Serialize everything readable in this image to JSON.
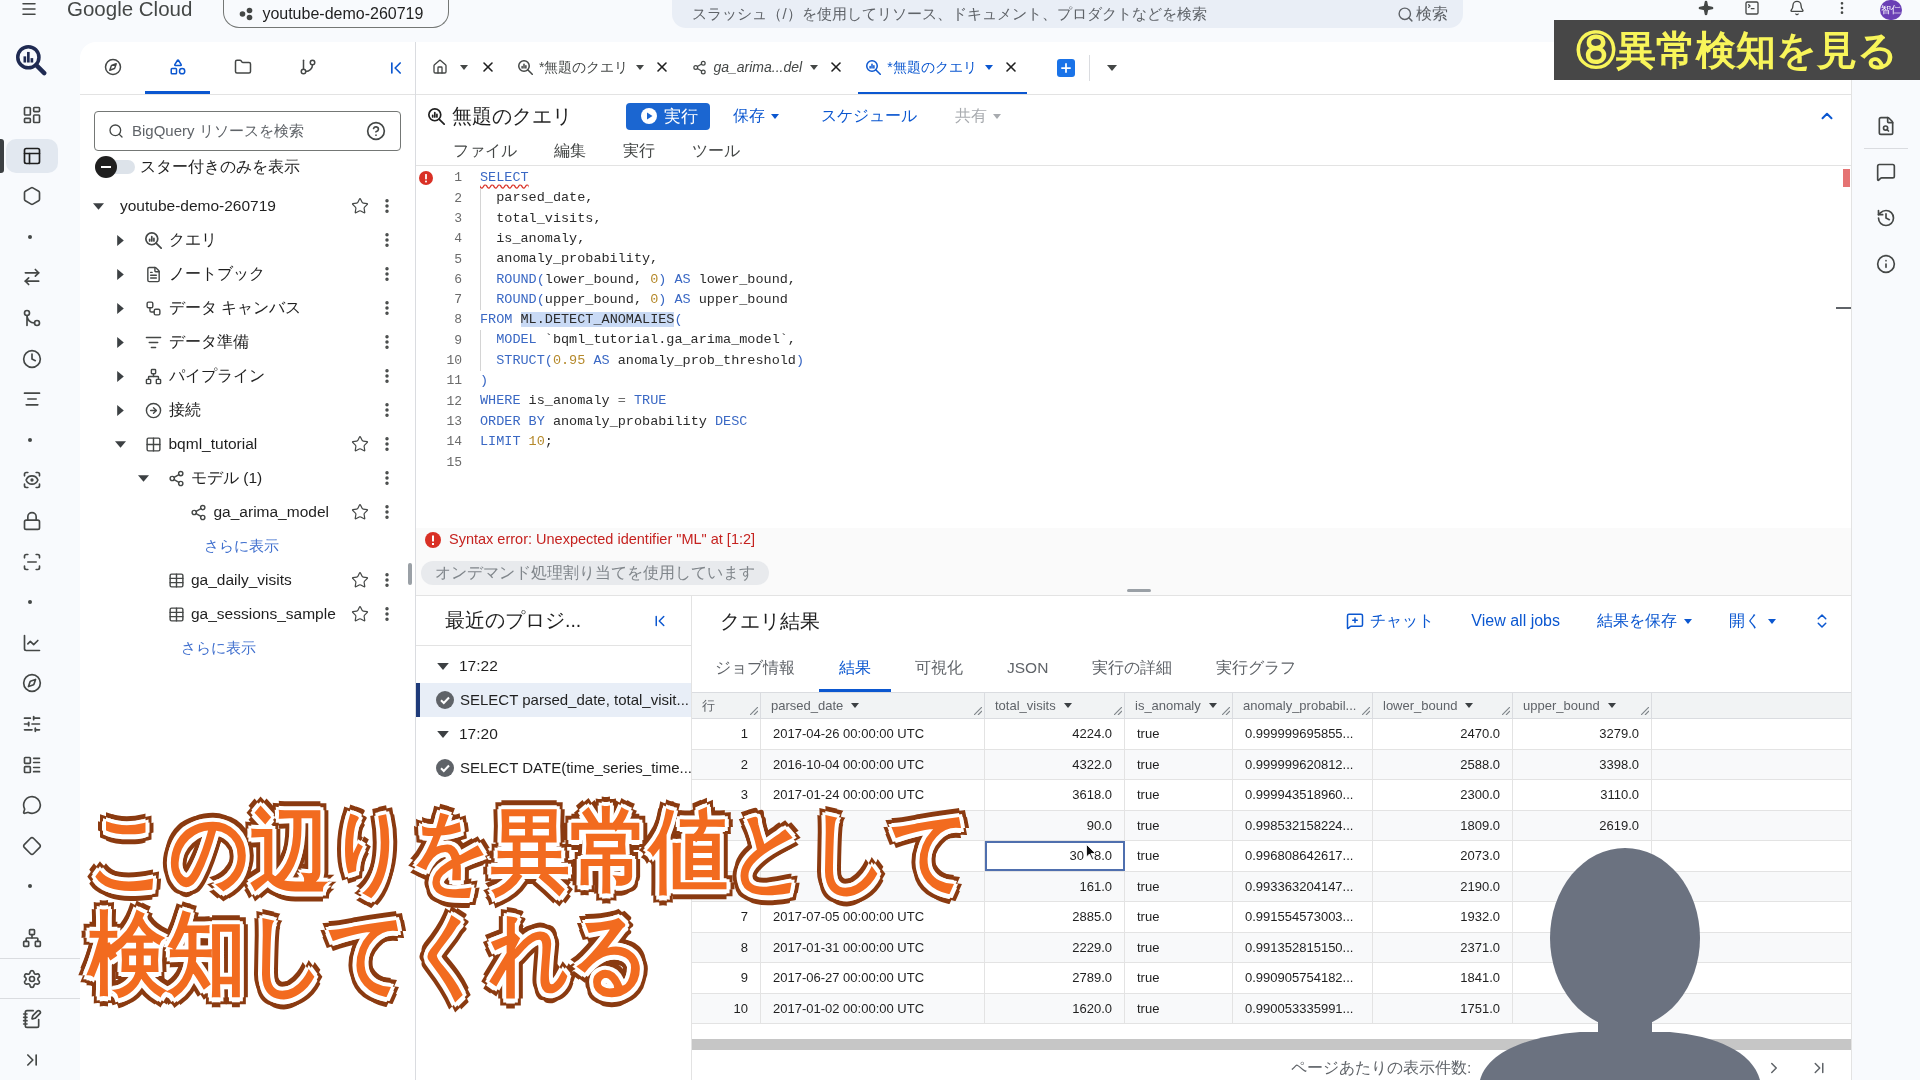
{
  "header": {
    "brand": "Google Cloud",
    "project": "youtube-demo-260719",
    "search": {
      "placeholder": "スラッシュ（/）を使用してリソース、ドキュメント、プロダクトなどを検索",
      "button": "検索"
    },
    "avatar": "智仁"
  },
  "rail": [
    {
      "kind": "dashboard",
      "selected": false
    },
    {
      "kind": "studio",
      "selected": true
    },
    {
      "kind": "hexagon",
      "selected": false
    },
    {
      "kind": "dot"
    },
    {
      "kind": "transfer",
      "selected": false
    },
    {
      "kind": "merge",
      "selected": false
    },
    {
      "kind": "clock",
      "selected": false
    },
    {
      "kind": "lines",
      "selected": false
    },
    {
      "kind": "dot"
    },
    {
      "kind": "scan_eye",
      "selected": false
    },
    {
      "kind": "lock",
      "selected": false
    },
    {
      "kind": "scan",
      "selected": false
    },
    {
      "kind": "dot"
    },
    {
      "kind": "chart",
      "selected": false
    },
    {
      "kind": "compass",
      "selected": false
    },
    {
      "kind": "sliders",
      "selected": false
    },
    {
      "kind": "table",
      "selected": false
    },
    {
      "kind": "chat",
      "selected": false
    },
    {
      "kind": "diamond",
      "selected": false
    },
    {
      "kind": "dot"
    },
    {
      "kind": "network",
      "selected": false
    },
    {
      "kind": "settings",
      "selected": false
    },
    {
      "kind": "notes",
      "selected": false
    },
    {
      "kind": "expand",
      "selected": false
    }
  ],
  "explorer": {
    "tabs": [
      {
        "kind": "explore",
        "selected": false
      },
      {
        "kind": "classic",
        "selected": true
      },
      {
        "kind": "files",
        "selected": false
      },
      {
        "kind": "repos",
        "selected": false
      }
    ],
    "search": {
      "placeholder": "BigQuery リソースを検索"
    },
    "starred_toggle": {
      "label": "スター付きのみを表示",
      "on": false
    },
    "tree": [
      {
        "kind": "project",
        "label": "youtube-demo-260719",
        "expanded": true,
        "star": true,
        "children": [
          {
            "kind": "queries",
            "label": "クエリ",
            "expanded": false,
            "star": false
          },
          {
            "kind": "notebooks",
            "label": "ノートブック",
            "expanded": false,
            "star": false
          },
          {
            "kind": "canvases",
            "label": "データ キャンバス",
            "expanded": false,
            "star": false
          },
          {
            "kind": "data_prep",
            "label": "データ準備",
            "expanded": false,
            "star": false
          },
          {
            "kind": "pipelines",
            "label": "パイプライン",
            "expanded": false,
            "star": false
          },
          {
            "kind": "connections",
            "label": "接続",
            "expanded": false,
            "star": false
          },
          {
            "kind": "dataset",
            "label": "bqml_tutorial",
            "expanded": true,
            "star": true,
            "children": [
              {
                "kind": "models",
                "label": "モデル (1)",
                "expanded": true,
                "star": false,
                "children": [
                  {
                    "kind": "model",
                    "label": "ga_arima_model",
                    "star": true
                  },
                  {
                    "kind": "more",
                    "label": "さらに表示"
                  }
                ]
              },
              {
                "kind": "table",
                "label": "ga_daily_visits",
                "star": true
              },
              {
                "kind": "table",
                "label": "ga_sessions_sample",
                "star": true
              },
              {
                "kind": "more",
                "label": "さらに表示"
              }
            ]
          }
        ]
      }
    ]
  },
  "editor_tabs": [
    {
      "kind": "home",
      "selected": false
    },
    {
      "kind": "query",
      "label": "*無題のクエリ",
      "selected": false
    },
    {
      "kind": "model",
      "label": "ga_arima...del",
      "selected": false
    },
    {
      "kind": "query",
      "label": "*無題のクエリ",
      "selected": true
    }
  ],
  "query": {
    "title": "無題のクエリ",
    "run": "実行",
    "actions": [
      {
        "label": "保存",
        "dropdown": true,
        "disabled": false
      },
      {
        "label": "スケジュール",
        "dropdown": false,
        "disabled": false
      },
      {
        "label": "共有",
        "dropdown": true,
        "disabled": true
      }
    ],
    "menu": [
      "ファイル",
      "編集",
      "実行",
      "ツール"
    ]
  },
  "code": [
    {
      "n": "1",
      "error": true,
      "tokens": [
        {
          "text": "SELECT",
          "kind": "kw",
          "selected": false
        }
      ],
      "children": [
        {
          "n": "2",
          "error": false,
          "tokens": [
            {
              "text": "parsed_date,",
              "kind": "id",
              "selected": false
            }
          ]
        },
        {
          "n": "3",
          "error": false,
          "tokens": [
            {
              "text": "total_visits,",
              "kind": "id",
              "selected": false
            }
          ]
        },
        {
          "n": "4",
          "error": false,
          "tokens": [
            {
              "text": "is_anomaly,",
              "kind": "id",
              "selected": false
            }
          ]
        },
        {
          "n": "5",
          "error": false,
          "tokens": [
            {
              "text": "anomaly_probability,",
              "kind": "id",
              "selected": false
            }
          ]
        },
        {
          "n": "6",
          "error": false,
          "tokens": [
            {
              "text": "ROUND(",
              "kind": "kw",
              "selected": false
            },
            {
              "text": "lower_bound, ",
              "kind": "id",
              "selected": false
            },
            {
              "text": "0",
              "kind": "num",
              "selected": false
            },
            {
              "text": ") AS ",
              "kind": "kw",
              "selected": false
            },
            {
              "text": "lower_bound,",
              "kind": "id",
              "selected": false
            }
          ]
        },
        {
          "n": "7",
          "error": false,
          "tokens": [
            {
              "text": "ROUND(",
              "kind": "kw",
              "selected": false
            },
            {
              "text": "upper_bound, ",
              "kind": "id",
              "selected": false
            },
            {
              "text": "0",
              "kind": "num",
              "selected": false
            },
            {
              "text": ") AS ",
              "kind": "kw",
              "selected": false
            },
            {
              "text": "upper_bound",
              "kind": "id",
              "selected": false
            }
          ]
        }
      ]
    },
    {
      "n": "8",
      "error": false,
      "tokens": [
        {
          "text": "FROM ",
          "kind": "kw",
          "selected": false
        },
        {
          "text": "ML.DETECT_ANOMALIES",
          "kind": "id",
          "selected": true
        },
        {
          "text": "(",
          "kind": "kw",
          "selected": false
        }
      ],
      "children": [
        {
          "n": "9",
          "error": false,
          "tokens": [
            {
              "text": "MODEL ",
              "kind": "kw",
              "selected": false
            },
            {
              "text": "`bqml_tutorial.ga_arima_model`,",
              "kind": "id",
              "selected": false
            }
          ]
        },
        {
          "n": "10",
          "error": false,
          "tokens": [
            {
              "text": "STRUCT(",
              "kind": "kw",
              "selected": false
            },
            {
              "text": "0.95",
              "kind": "num",
              "selected": false
            },
            {
              "text": " AS ",
              "kind": "kw",
              "selected": false
            },
            {
              "text": "anomaly_prob_threshold",
              "kind": "id",
              "selected": false
            },
            {
              "text": ")",
              "kind": "kw",
              "selected": false
            }
          ]
        }
      ]
    },
    {
      "n": "11",
      "error": false,
      "tokens": [
        {
          "text": ")",
          "kind": "kw",
          "selected": false
        }
      ]
    },
    {
      "n": "12",
      "error": false,
      "tokens": [
        {
          "text": "WHERE ",
          "kind": "kw",
          "selected": false
        },
        {
          "text": "is_anomaly ",
          "kind": "id",
          "selected": false
        },
        {
          "text": "= ",
          "kind": "op",
          "selected": false
        },
        {
          "text": "TRUE",
          "kind": "kw",
          "selected": false
        }
      ]
    },
    {
      "n": "13",
      "error": false,
      "tokens": [
        {
          "text": "ORDER BY ",
          "kind": "kw",
          "selected": false
        },
        {
          "text": "anomaly_probability ",
          "kind": "id",
          "selected": false
        },
        {
          "text": "DESC",
          "kind": "kw",
          "selected": false
        }
      ]
    },
    {
      "n": "14",
      "error": false,
      "tokens": [
        {
          "text": "LIMIT ",
          "kind": "kw",
          "selected": false
        },
        {
          "text": "10",
          "kind": "num",
          "selected": false
        },
        {
          "text": ";",
          "kind": "id",
          "selected": false
        }
      ]
    },
    {
      "n": "15",
      "error": false
    }
  ],
  "error": "Syntax error: Unexpected identifier \"ML\" at [1:2]",
  "status_chip": "オンデマンド処理割り当てを使用しています",
  "history": {
    "title": "最近のプロジ...",
    "groups": [
      {
        "time": "17:22",
        "expanded": true,
        "jobs": [
          {
            "text": "SELECT parsed_date, total_visit...",
            "selected": true
          }
        ]
      },
      {
        "time": "17:20",
        "expanded": true,
        "jobs": [
          {
            "text": "SELECT DATE(time_series_time...",
            "selected": false
          }
        ]
      }
    ]
  },
  "results": {
    "title": "クエリ結果",
    "actions": [
      {
        "kind": "chat",
        "label": "チャット"
      },
      {
        "kind": "link",
        "label": "View all jobs"
      },
      {
        "kind": "menu",
        "label": "結果を保存"
      },
      {
        "kind": "menu",
        "label": "開く"
      }
    ],
    "tabs": [
      {
        "label": "ジョブ情報",
        "selected": false
      },
      {
        "label": "結果",
        "selected": true
      },
      {
        "label": "可視化",
        "selected": false
      },
      {
        "label": "JSON",
        "selected": false
      },
      {
        "label": "実行の詳細",
        "selected": false
      },
      {
        "label": "実行グラフ",
        "selected": false
      }
    ],
    "table": {
      "columns": [
        {
          "label": "行",
          "kind": "number",
          "menu": false
        },
        {
          "label": "parsed_date",
          "kind": "text",
          "menu": true
        },
        {
          "label": "total_visits",
          "kind": "number",
          "menu": true
        },
        {
          "label": "is_anomaly",
          "kind": "text",
          "menu": true
        },
        {
          "label": "anomaly_probabil...",
          "kind": "text",
          "menu": false
        },
        {
          "label": "lower_bound",
          "kind": "number",
          "menu": true
        },
        {
          "label": "upper_bound",
          "kind": "number",
          "menu": true
        }
      ],
      "rows": [
        [
          "1",
          "2017-04-26 00:00:00 UTC",
          "4224.0",
          "true",
          "0.999999695855...",
          "2470.0",
          "3279.0"
        ],
        [
          "2",
          "2016-10-04 00:00:00 UTC",
          "4322.0",
          "true",
          "0.999999620812...",
          "2588.0",
          "3398.0"
        ],
        [
          "3",
          "2017-01-24 00:00:00 UTC",
          "3618.0",
          "true",
          "0.999943518960...",
          "2300.0",
          "3110.0"
        ],
        [
          null,
          null,
          "90.0",
          "true",
          "0.998532158224...",
          "1809.0",
          "2619.0"
        ],
        [
          null,
          null,
          {
            "parts": [
              "30",
              "8.0"
            ],
            "focused": true
          },
          "true",
          "0.996808642617...",
          "2073.0",
          null
        ],
        [
          null,
          null,
          "161.0",
          "true",
          "0.993363204147...",
          "2190.0",
          null
        ],
        [
          "7",
          "2017-07-05 00:00:00 UTC",
          "2885.0",
          "true",
          "0.991554573003...",
          "1932.0",
          null
        ],
        [
          "8",
          "2017-01-31 00:00:00 UTC",
          "2229.0",
          "true",
          "0.991352815150...",
          "2371.0",
          null
        ],
        [
          "9",
          "2017-06-27 00:00:00 UTC",
          "2789.0",
          "true",
          "0.990905754182...",
          "1841.0",
          null
        ],
        [
          "10",
          "2017-01-02 00:00:00 UTC",
          "1620.0",
          "true",
          "0.990053335991...",
          "1751.0",
          null
        ]
      ]
    },
    "footer": {
      "page_size_label": "ページあたりの表示件数:"
    }
  },
  "overlay": {
    "banner": "⑧異常検知を見る",
    "caption": [
      "この辺りを異常値として",
      "検知してくれる"
    ]
  }
}
